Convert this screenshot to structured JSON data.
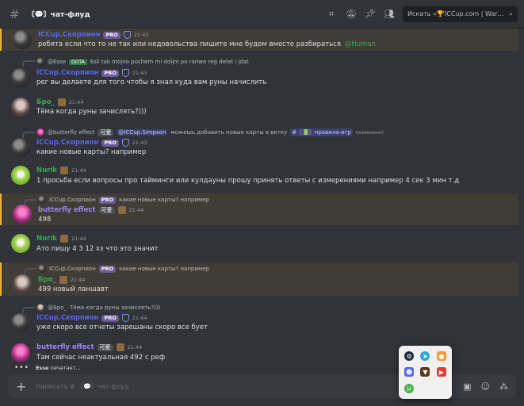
{
  "header": {
    "channel_name": "〘💬〙чат-флуд",
    "search_placeholder": "Искать «🏆ICCup.com | WarCraf...",
    "icons": [
      "threads-icon",
      "mute-icon",
      "pin-icon",
      "members-icon",
      "search-icon"
    ]
  },
  "messages": [
    {
      "author": "ICCup.Скорпион",
      "badge": "PRO",
      "time": "21:43",
      "text": "ребята если что то не так  или недовольства пишите мне будем вместе разбираться",
      "mention": "@Human",
      "highlight": true
    },
    {
      "reply_name": "@Esse",
      "reply_badge": "DOTA",
      "reply_text": "Esli tak mojno pochem mi doljni po ranwe reg delat i jdat",
      "author": "ICCup.Скорпион",
      "badge": "PRO",
      "time": "21:43",
      "text": "рег вы делаете для того чтобы я знал куда вам руны начислить"
    },
    {
      "author": "Бро_",
      "time": "21:44",
      "text": "Тёма когда руны зачислять?)))"
    },
    {
      "reply_name": "@butterfly effect",
      "reply_badge": "可爱",
      "reply_mention": "@ICCup.Simpson",
      "reply_text": "можешь добавить новые карты в ветку",
      "reply_channel": "#〘📗〙правила-игр",
      "reply_edited": "(изменено)",
      "author": "ICCup.Скорпион",
      "badge": "PRO",
      "time": "21:43",
      "text": "какие новые карты? например"
    },
    {
      "author": "Nurik",
      "time": "21:44",
      "text": "1 просьба если вопросы про тайминги или кулдауны прошу принять ответы с измерениями например 4 сек 3 мин т.д"
    },
    {
      "reply_name": "ICCup.Скорпион",
      "reply_badge": "PRO",
      "reply_text": "какие новые карты? например",
      "author": "butterfly effect",
      "badge": "可爱",
      "time": "21:44",
      "text": "498",
      "highlight": true
    },
    {
      "author": "Nurik",
      "time": "21:44",
      "text": "Ато пишу 4 3 12 хз что это значит"
    },
    {
      "reply_name": "ICCup.Скорпион",
      "reply_badge": "PRO",
      "reply_text": "какие новые карты? например",
      "author": "Бро_",
      "time": "21:44",
      "text": "499 новый ланшавт",
      "highlight": true
    },
    {
      "reply_name": "@Бро_",
      "reply_text": "Тёма когда руны зачислять?)))",
      "author": "ICCup.Скорпион",
      "badge": "PRO",
      "time": "21:44",
      "text": "уже скоро все отчеты зарешаны скоро все бует"
    },
    {
      "author": "butterfly effect",
      "badge": "可爱",
      "time": "21:44",
      "text": "Там сейчас неактуальная 492 с реф"
    }
  ],
  "typing": {
    "user": "Esse",
    "suffix": "печатает..."
  },
  "composer": {
    "placeholder": "Написать # 〘💬〙чат-флуд"
  },
  "tray_icons": [
    "steam-icon",
    "telegram-icon",
    "app-icon",
    "discord-icon",
    "warcraft-icon",
    "video-icon",
    "utorrent-icon"
  ],
  "colors": {
    "bg": "#313338",
    "accent": "#5865f2",
    "mention": "#f0b232"
  }
}
